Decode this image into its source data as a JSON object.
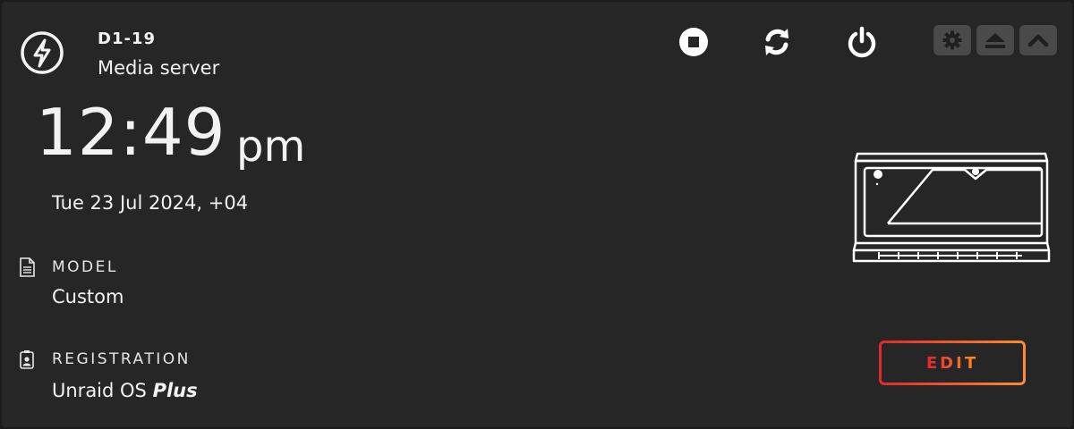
{
  "server": {
    "hostname": "D1-19",
    "description": "Media server"
  },
  "controls": {
    "stop_icon": "stop-icon",
    "reboot_icon": "refresh-icon",
    "power_icon": "power-icon",
    "settings_icon": "gear-icon",
    "eject_icon": "eject-icon",
    "collapse_icon": "chevron-up-icon"
  },
  "clock": {
    "time": "12:49",
    "ampm": "pm",
    "date": "Tue 23 Jul 2024, +04"
  },
  "model": {
    "label": "MODEL",
    "value": "Custom"
  },
  "registration": {
    "label": "REGISTRATION",
    "os_name": "Unraid OS",
    "edition": "Plus"
  },
  "edit_button": {
    "label": "EDIT"
  },
  "colors": {
    "background": "#262626",
    "text": "#f2f2f2",
    "mini_button": "#4a4a4a",
    "accent_start": "#e22828",
    "accent_end": "#ff8c2f"
  }
}
